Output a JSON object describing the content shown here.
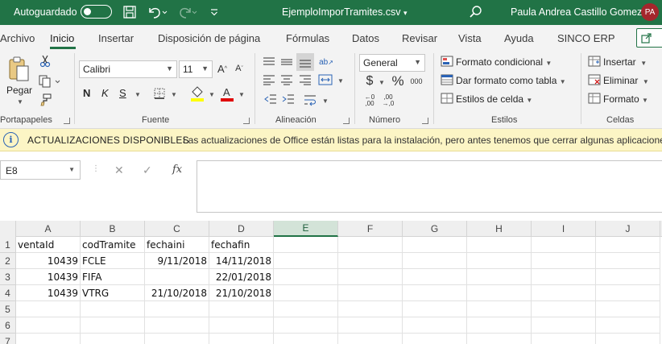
{
  "titlebar": {
    "autosave_label": "Autoguardado",
    "doc_title": "EjemploImporTramites.csv",
    "doc_title_chevron": "▾",
    "user_name": "Paula Andrea Castillo Gomez",
    "avatar_initials": "PA",
    "bg_color": "#217346"
  },
  "tabs": [
    "Archivo",
    "Inicio",
    "Insertar",
    "Disposición de página",
    "Fórmulas",
    "Datos",
    "Revisar",
    "Vista",
    "Ayuda",
    "SINCO ERP"
  ],
  "active_tab": "Inicio",
  "ribbon": {
    "clipboard": {
      "label": "Portapapeles",
      "paste_label": "Pegar"
    },
    "font": {
      "label": "Fuente",
      "font_name": "Calibri",
      "font_size": "11",
      "bold": "N",
      "italic": "K",
      "underline": "S"
    },
    "alignment": {
      "label": "Alineación"
    },
    "number": {
      "label": "Número",
      "format": "General"
    },
    "styles": {
      "label": "Estilos",
      "conditional": "Formato condicional",
      "as_table": "Dar formato como tabla",
      "cell_styles": "Estilos de celda"
    },
    "cells": {
      "label": "Celdas",
      "insert": "Insertar",
      "delete": "Eliminar",
      "format": "Formato"
    }
  },
  "infobar": {
    "title": "ACTUALIZACIONES DISPONIBLES",
    "message": "Las actualizaciones de Office están listas para la instalación, pero antes tenemos que cerrar algunas aplicaciones."
  },
  "formula_bar": {
    "name_box": "E8",
    "content": ""
  },
  "sheet": {
    "columns": [
      "A",
      "B",
      "C",
      "D",
      "E",
      "F",
      "G",
      "H",
      "I",
      "J"
    ],
    "selected_column": "E",
    "row_numbers": [
      "1",
      "2",
      "3",
      "4",
      "5",
      "6",
      "7"
    ],
    "rows": [
      [
        "ventaId",
        "codTramite",
        "fechaini",
        "fechafin"
      ],
      [
        "10439",
        "FCLE",
        "9/11/2018",
        "14/11/2018"
      ],
      [
        "10439",
        "FIFA",
        "",
        "22/01/2018"
      ],
      [
        "10439",
        "VTRG",
        "21/10/2018",
        "21/10/2018"
      ]
    ],
    "numeric_columns": [
      0,
      2,
      3
    ],
    "header_row_left_aligned": true
  }
}
